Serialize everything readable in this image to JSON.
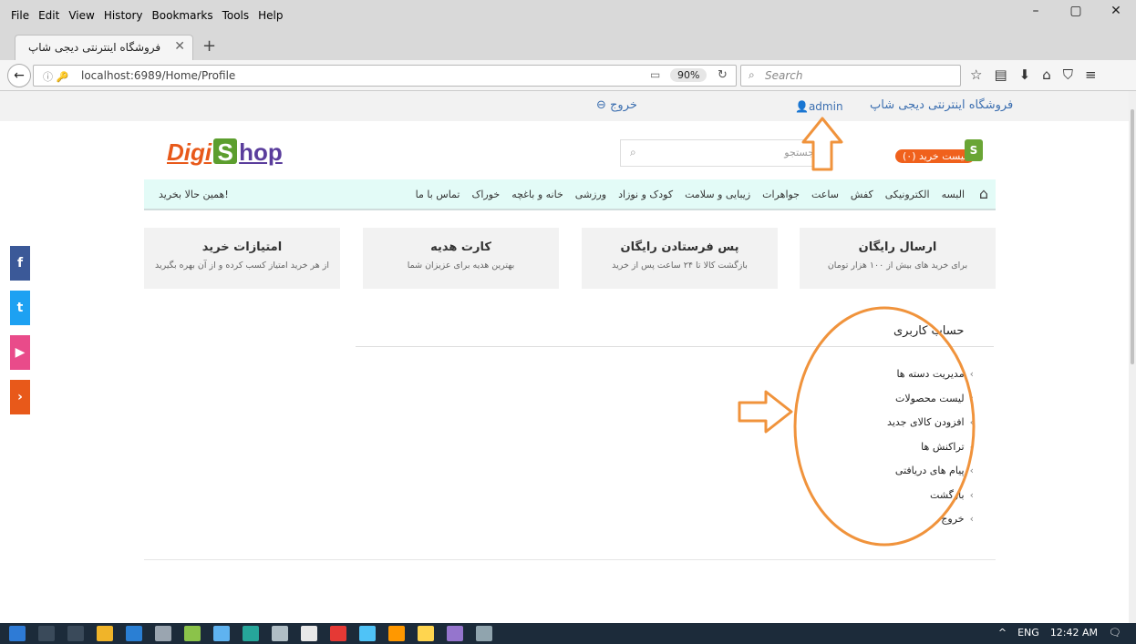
{
  "browser": {
    "menu": [
      "File",
      "Edit",
      "View",
      "History",
      "Bookmarks",
      "Tools",
      "Help"
    ],
    "window_controls": [
      "–",
      "▢",
      "✕"
    ],
    "tab": {
      "title": "فروشگاه اینترنتی دیجی شاپ",
      "close": "✕",
      "new_tab": "+"
    },
    "back": "←",
    "url": "localhost:6989/Home/Profile",
    "info_icon": "ⓘ 🔑",
    "reader_icon": "▭",
    "zoom": "90%",
    "reload": "↻",
    "search_placeholder": "Search",
    "search_icon": "⌕",
    "toolbar_icons": [
      "☆",
      "▤",
      "⬇",
      "⌂",
      "⛉",
      "≡"
    ]
  },
  "site": {
    "store_title": "فروشگاه اینترنتی دیجی شاپ",
    "admin_label": "admin",
    "user_icon": "👤",
    "logout": "⊖ خروج",
    "logo": {
      "a": "Digi",
      "s": "S",
      "b": "hop"
    },
    "search_placeholder": "جستجو",
    "search_icon": "⌕",
    "cart": "لیست خرید (۰)",
    "cart_icon": "S",
    "home_icon": "⌂",
    "categories": [
      "البسه",
      "الکترونیکی",
      "کفش",
      "ساعت",
      "جواهرات",
      "زیبایی و سلامت",
      "کودک و نوزاد",
      "ورزشی",
      "خانه و باغچه",
      "خوراک",
      "تماس با ما"
    ],
    "buy_now": "همین حالا بخرید!",
    "features": [
      {
        "title": "امتیازات خرید",
        "desc": "از هر خرید امتیاز کسب کرده و از آن بهره بگیرید"
      },
      {
        "title": "کارت هدیه",
        "desc": "بهترین هدیه برای عزیزان شما"
      },
      {
        "title": "پس فرستادن رایگان",
        "desc": "بازگشت کالا تا ۲۴ ساعت پس از خرید"
      },
      {
        "title": "ارسال رایگان",
        "desc": "برای خرید های بیش از ۱۰۰ هزار تومان"
      }
    ],
    "social": [
      {
        "glyph": "f",
        "color": "#3b5998"
      },
      {
        "glyph": "t",
        "color": "#1da1f2"
      },
      {
        "glyph": "▶",
        "color": "#e94b8a"
      },
      {
        "glyph": "›",
        "color": "#e8591a"
      }
    ],
    "account": {
      "title": "حساب کاربری",
      "chevron": "›",
      "items": [
        "مدیریت دسته ها",
        "لیست محصولات",
        "افزودن کالای جدید",
        "تراکنش ها",
        "پیام های دریافتی",
        "بازگشت",
        "خروج"
      ]
    }
  },
  "annotation_color": "#f0933c",
  "taskbar": {
    "tray": [
      "^",
      "ENG",
      "12:42 AM",
      "🗨"
    ]
  }
}
